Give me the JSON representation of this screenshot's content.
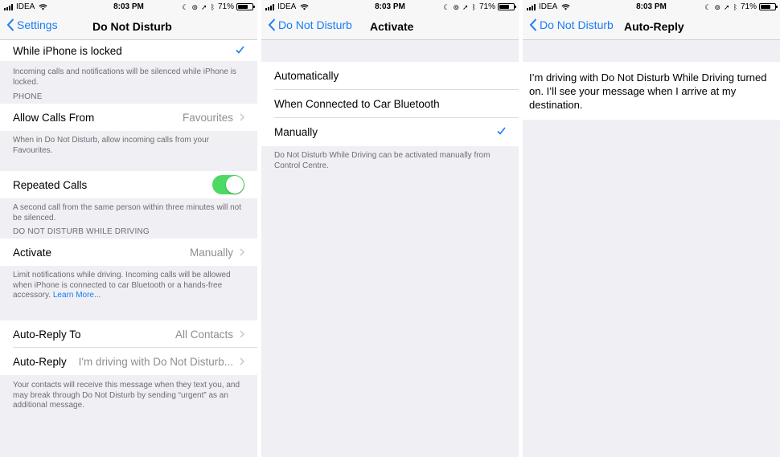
{
  "status": {
    "carrier": "IDEA",
    "time": "8:03 PM",
    "battery": "71%",
    "battery_level": 0.71
  },
  "colors": {
    "accent": "#1a7cf4",
    "toggle_on": "#4cd964",
    "background": "#efeff4"
  },
  "panel1": {
    "back_label": "Settings",
    "title": "Do Not Disturb",
    "locked_row": "While iPhone is locked",
    "locked_note": "Incoming calls and notifications will be silenced while iPhone is locked.",
    "phone_header": "PHONE",
    "allow_calls_label": "Allow Calls From",
    "allow_calls_value": "Favourites",
    "allow_calls_note": "When in Do Not Disturb, allow incoming calls from your Favourites.",
    "repeated_calls_label": "Repeated Calls",
    "repeated_calls_on": true,
    "repeated_calls_note": "A second call from the same person within three minutes will not be silenced.",
    "driving_header": "DO NOT DISTURB WHILE DRIVING",
    "activate_label": "Activate",
    "activate_value": "Manually",
    "activate_note": "Limit notifications while driving. Incoming calls will be allowed when iPhone is connected to car Bluetooth or a hands-free accessory.",
    "learn_more": "Learn More...",
    "auto_reply_to_label": "Auto-Reply To",
    "auto_reply_to_value": "All Contacts",
    "auto_reply_label": "Auto-Reply",
    "auto_reply_value": "I'm driving with Do Not Disturb...",
    "auto_reply_note": "Your contacts will receive this message when they text you, and may break through Do Not Disturb by sending “urgent” as an additional message."
  },
  "panel2": {
    "back_label": "Do Not Disturb",
    "title": "Activate",
    "options": [
      "Automatically",
      "When Connected to Car Bluetooth",
      "Manually"
    ],
    "selected": "Manually",
    "note": "Do Not Disturb While Driving can be activated manually from Control Centre."
  },
  "panel3": {
    "back_label": "Do Not Disturb",
    "title": "Auto-Reply",
    "message": "I’m driving with Do Not Disturb While Driving turned on. I’ll see your message when I arrive at my destination."
  }
}
